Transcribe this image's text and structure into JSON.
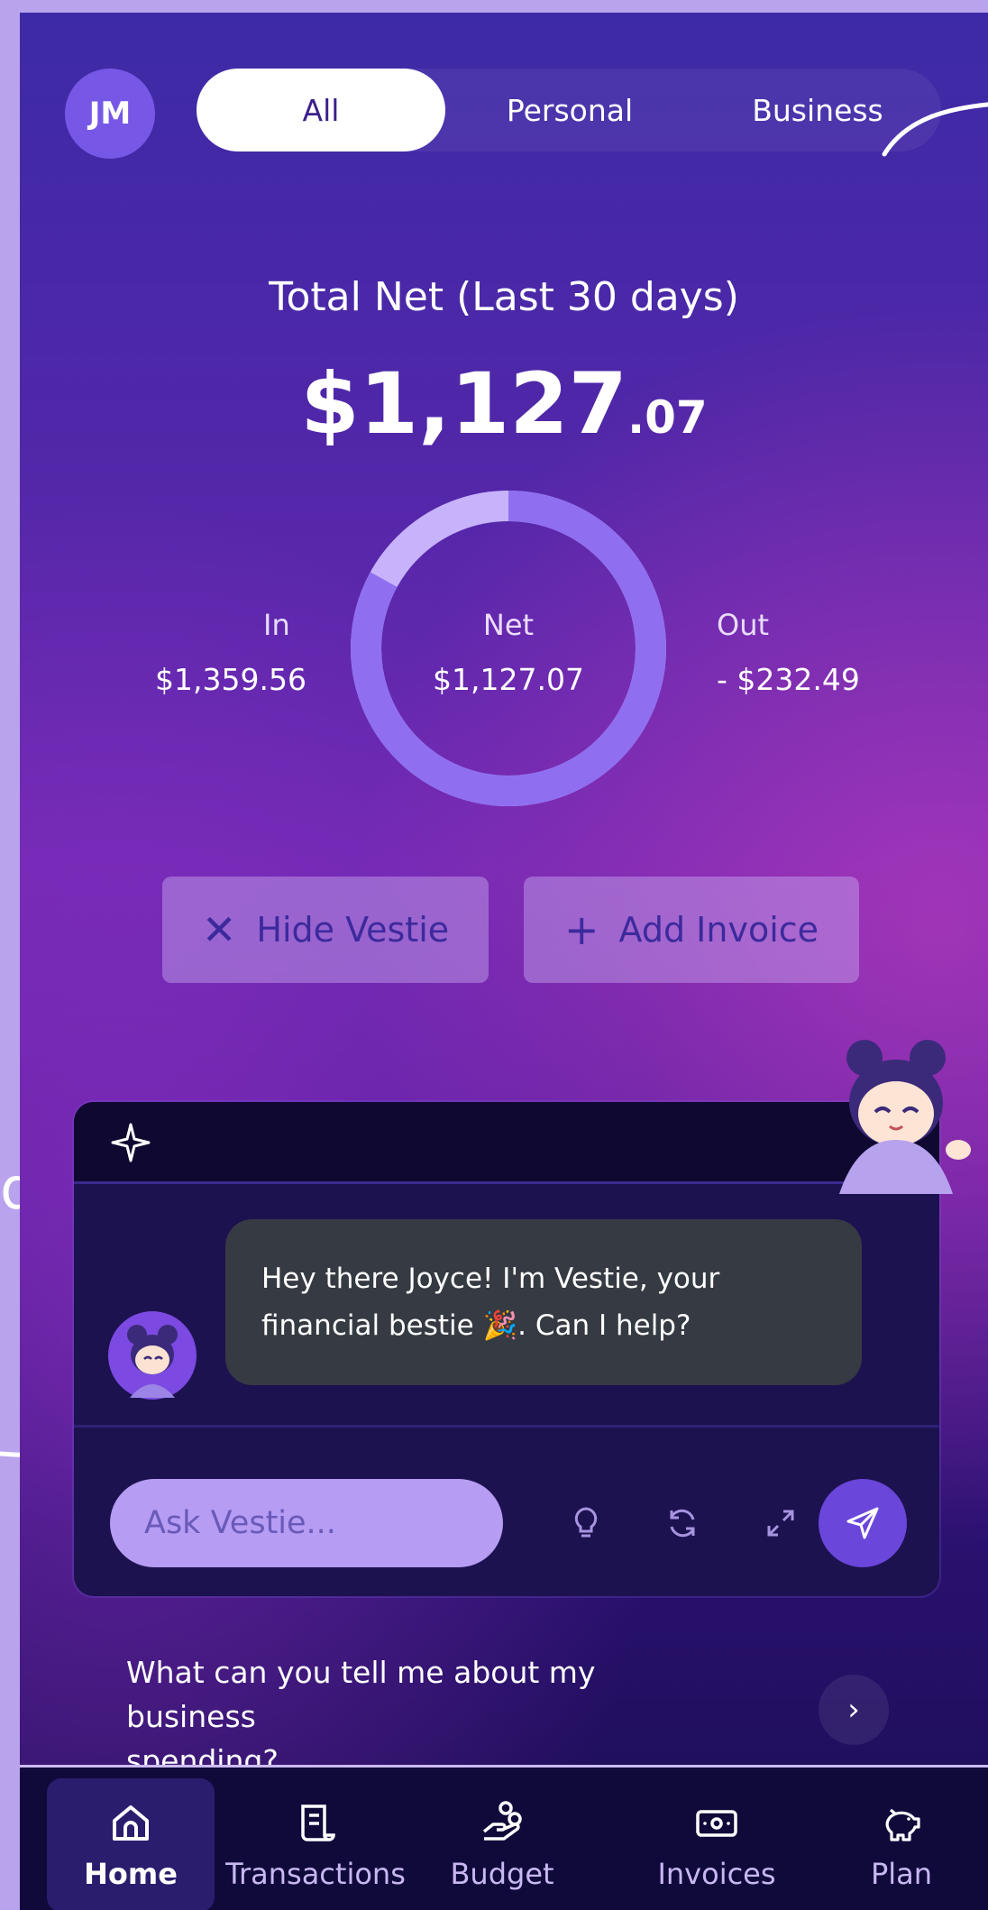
{
  "backdrop": {
    "partial_text": "d"
  },
  "header": {
    "avatar_initials": "JM",
    "tabs": [
      {
        "label": "All",
        "active": true
      },
      {
        "label": "Personal",
        "active": false
      },
      {
        "label": "Business",
        "active": false
      }
    ]
  },
  "summary": {
    "title": "Total Net (Last 30 days)",
    "total_whole": "$1,127",
    "total_cents": ".07",
    "in_label": "In",
    "in_value": "$1,359.56",
    "net_label": "Net",
    "net_value": "$1,127.07",
    "out_label": "Out",
    "out_value": "- $232.49",
    "ring_net_fraction": 0.83
  },
  "actions": {
    "hide_label": "Hide Vestie",
    "hide_icon": "close-icon",
    "add_label": "Add Invoice",
    "add_icon": "plus-icon"
  },
  "chat": {
    "header_icon": "sparkle-icon",
    "message_line1": "Hey there Joyce! I'm Vestie, your",
    "message_line2": "financial bestie 🎉. Can I help?",
    "input_placeholder": "Ask Vestie...",
    "tools": [
      "lightbulb-icon",
      "refresh-icon",
      "expand-icon"
    ],
    "send_icon": "send-icon"
  },
  "suggestion": {
    "text_line1": "What can you tell me about my business",
    "text_line2": "spending?",
    "arrow": "›"
  },
  "nav": {
    "items": [
      {
        "label": "Home",
        "icon": "home-icon",
        "active": true
      },
      {
        "label": "Transactions",
        "icon": "receipt-icon",
        "active": false
      },
      {
        "label": "Budget",
        "icon": "hand-coins-icon",
        "active": false
      },
      {
        "label": "Invoices",
        "icon": "banknote-icon",
        "active": false
      },
      {
        "label": "Plan",
        "icon": "piggy-bank-icon",
        "active": false
      }
    ]
  },
  "colors": {
    "accent": "#6a46da",
    "input_bg": "#b69cf3",
    "bubble_bg": "#363a42",
    "nav_bg": "#100a3a",
    "ring_light": "#c7b3fb",
    "ring_dark": "#8f6ff0"
  }
}
